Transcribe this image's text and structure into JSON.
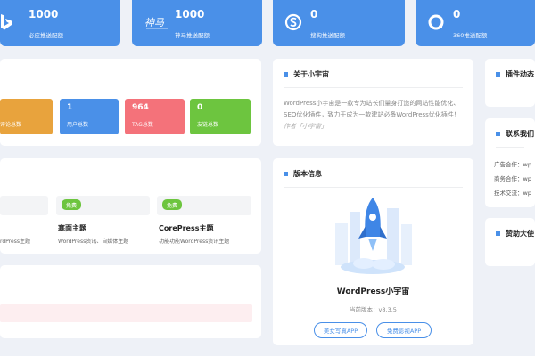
{
  "stats": [
    {
      "icon": "bing-icon",
      "value": "1000",
      "label": "必应推送配额"
    },
    {
      "icon": "shenma-icon",
      "value": "1000",
      "label": "神马推送配额"
    },
    {
      "icon": "sogou-icon",
      "value": "0",
      "label": "搜狗推送配额"
    },
    {
      "icon": "360-icon",
      "value": "0",
      "label": "360推送配额"
    }
  ],
  "counts": [
    {
      "value": "",
      "label": "评论总数"
    },
    {
      "value": "1",
      "label": "用户总数"
    },
    {
      "value": "964",
      "label": "TAG总数"
    },
    {
      "value": "0",
      "label": "友链总数"
    }
  ],
  "themes": [
    {
      "badge": "",
      "name": "",
      "desc": "rdPress主题"
    },
    {
      "badge": "免费",
      "name": "塞面主题",
      "desc": "WordPress资讯、自媒体主题"
    },
    {
      "badge": "免费",
      "name": "CorePress主题",
      "desc": "功能功能WordPress资讯主题"
    }
  ],
  "about": {
    "title": "关于小宇宙",
    "text": "WordPress小宇宙是一款专为站长们量身打造的网站性能优化、SEO优化插件，致力于成为一款建站必备WordPress优化插件！",
    "author": "作者「小宇宙」"
  },
  "version": {
    "title": "版本信息",
    "name": "WordPress小宇宙",
    "current": "当前版本：v8.3.5",
    "btn1": "美女写真APP",
    "btn2": "免费影视APP"
  },
  "right": {
    "plugin_title": "插件动态",
    "contact_title": "联系我们",
    "contacts": [
      "广告合作：wp",
      "商务合作：wp",
      "技术交流：wp"
    ],
    "sponsor_title": "赞助大使"
  },
  "colors": {
    "blue": "#4a90e8",
    "orange": "#e8a33d",
    "red": "#f4727a",
    "green": "#6dc53f"
  }
}
